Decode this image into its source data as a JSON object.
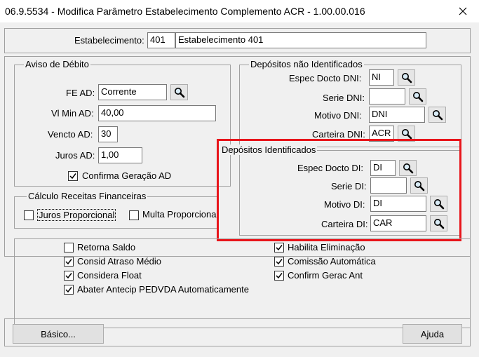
{
  "window": {
    "title": "06.9.5534 - Modifica Parâmetro Estabelecimento Complemento ACR - 1.00.00.016"
  },
  "estabelecimento": {
    "label": "Estabelecimento:",
    "code": "401",
    "name": "Estabelecimento 401"
  },
  "aviso_debito": {
    "title": "Aviso de Débito",
    "fe_ad_label": "FE AD:",
    "fe_ad_value": "Corrente",
    "vl_min_label": "Vl Min AD:",
    "vl_min_value": "40,00",
    "vencto_label": "Vencto AD:",
    "vencto_value": "30",
    "juros_label": "Juros AD:",
    "juros_value": "1,00",
    "confirma_label": "Confirma Geração AD",
    "confirma_checked": true
  },
  "calculo": {
    "title": "Cálculo Receitas Financeiras",
    "juros_label": "Juros Proporcional",
    "juros_checked": false,
    "multa_label": "Multa Proporciona",
    "multa_checked": false
  },
  "dep_nao_ident": {
    "title": "Depósitos não Identificados",
    "espec_label": "Espec Docto DNI:",
    "espec_value": "NI",
    "serie_label": "Serie DNI:",
    "serie_value": "",
    "motivo_label": "Motivo DNI:",
    "motivo_value": "DNI",
    "carteira_label": "Carteira DNI:",
    "carteira_value": "ACR"
  },
  "dep_ident": {
    "title": "Depósitos Identificados",
    "espec_label": "Espec Docto DI:",
    "espec_value": "DI",
    "serie_label": "Serie DI:",
    "serie_value": "",
    "motivo_label": "Motivo DI:",
    "motivo_value": "DI",
    "carteira_label": "Carteira DI:",
    "carteira_value": "CAR"
  },
  "options": {
    "retorna_saldo": "Retorna Saldo",
    "consid_atraso": "Consid Atraso Médio",
    "considera_float": "Considera Float",
    "abater_antecip": "Abater Antecip PEDVDA Automaticamente",
    "habilita_elim": "Habilita Eliminação",
    "comissao_auto": "Comissão Automática",
    "confirm_gerac": "Confirm Gerac Ant"
  },
  "buttons": {
    "basico": "Básico...",
    "ajuda": "Ajuda"
  },
  "colors": {
    "highlight": "#e8141a",
    "background": "#f0f0f0"
  }
}
